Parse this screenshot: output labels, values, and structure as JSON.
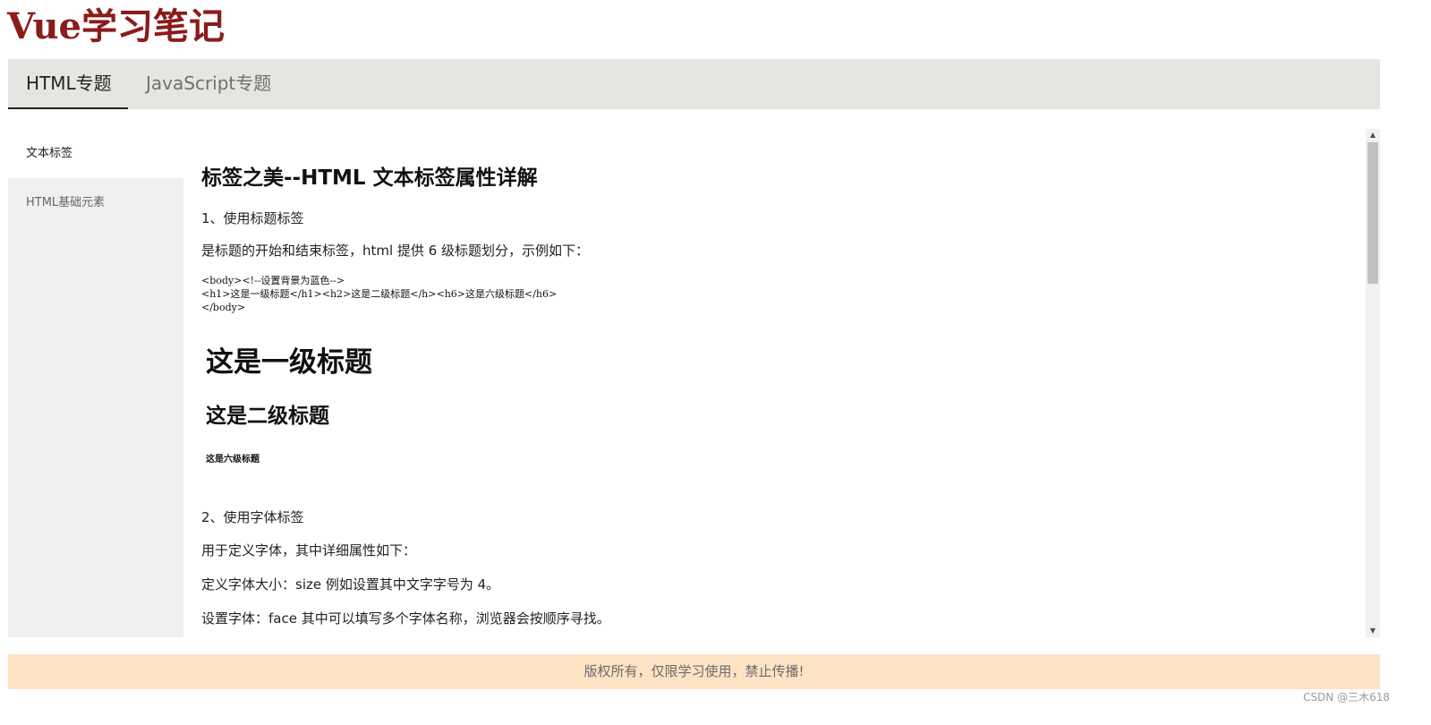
{
  "site": {
    "title": "Vue学习笔记"
  },
  "nav": {
    "tabs": [
      {
        "label": "HTML专题",
        "active": true
      },
      {
        "label": "JavaScript专题",
        "active": false
      }
    ]
  },
  "sidebar": {
    "items": [
      {
        "label": "文本标签",
        "active": true
      },
      {
        "label": "HTML基础元素",
        "active": false
      }
    ]
  },
  "content": {
    "title": "标签之美--HTML 文本标签属性详解",
    "section1_heading": "1、使用标题标签",
    "section1_desc": "是标题的开始和结束标签，html 提供 6 级标题划分，示例如下：",
    "code_lines": [
      "<body><!--设置背景为蓝色-->",
      "<h1>这是一级标题</h1><h2>这是二级标题</h><h6>这是六级标题</h6>",
      "</body>"
    ],
    "demo_h1": "这是一级标题",
    "demo_h2": "这是二级标题",
    "demo_h6": "这是六级标题",
    "section2_heading": "2、使用字体标签",
    "section2_desc": "用于定义字体，其中详细属性如下：",
    "font_size_line": "定义字体大小：size  例如设置其中文字字号为 4。",
    "font_face_line": "设置字体：face 其中可以填写多个字体名称，浏览器会按顺序寻找。"
  },
  "footer": {
    "text": "版权所有，仅限学习使用，禁止传播!"
  },
  "watermark": {
    "text": "CSDN @三木618"
  },
  "colors": {
    "title": "#8b1c1c",
    "navbar_bg": "#e7e5e2",
    "sidebar_bg": "#f0f0f0",
    "footer_bg": "#fde3c4"
  }
}
